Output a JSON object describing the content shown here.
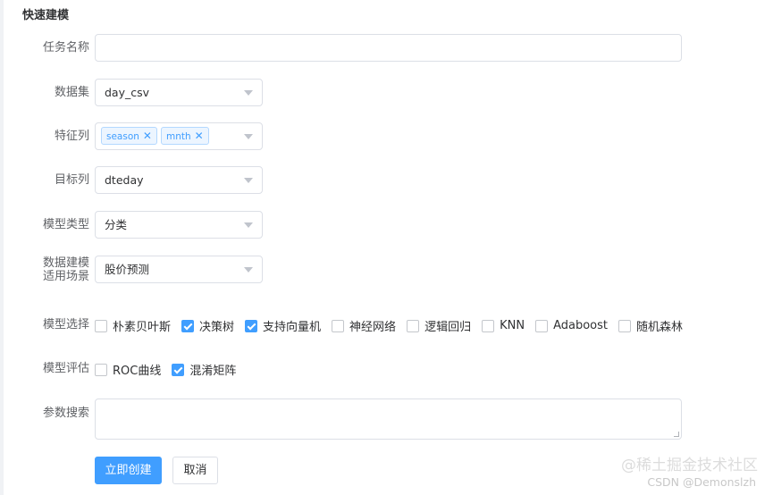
{
  "section_title": "快速建模",
  "form": {
    "task_name": {
      "label": "任务名称",
      "value": ""
    },
    "dataset": {
      "label": "数据集",
      "value": "day_csv"
    },
    "features": {
      "label": "特征列",
      "tags": [
        "season",
        "mnth"
      ]
    },
    "target": {
      "label": "目标列",
      "value": "dteday"
    },
    "model_type": {
      "label": "模型类型",
      "value": "分类"
    },
    "scenario": {
      "label_line1": "数据建模",
      "label_line2": "适用场景",
      "value": "股价预测"
    },
    "model_select": {
      "label": "模型选择",
      "options": [
        {
          "label": "朴素贝叶斯",
          "checked": false
        },
        {
          "label": "决策树",
          "checked": true
        },
        {
          "label": "支持向量机",
          "checked": true
        },
        {
          "label": "神经网络",
          "checked": false
        },
        {
          "label": "逻辑回归",
          "checked": false
        },
        {
          "label": "KNN",
          "checked": false
        },
        {
          "label": "Adaboost",
          "checked": false
        },
        {
          "label": "随机森林",
          "checked": false
        }
      ]
    },
    "model_eval": {
      "label": "模型评估",
      "options": [
        {
          "label": "ROC曲线",
          "checked": false
        },
        {
          "label": "混淆矩阵",
          "checked": true
        }
      ]
    },
    "param_search": {
      "label": "参数搜索",
      "value": ""
    }
  },
  "buttons": {
    "create": "立即创建",
    "cancel": "取消"
  },
  "watermark": {
    "line1": "@稀土掘金技术社区",
    "line2": "CSDN @Demonslzh"
  },
  "colors": {
    "primary": "#409eff",
    "border": "#dcdfe6"
  }
}
